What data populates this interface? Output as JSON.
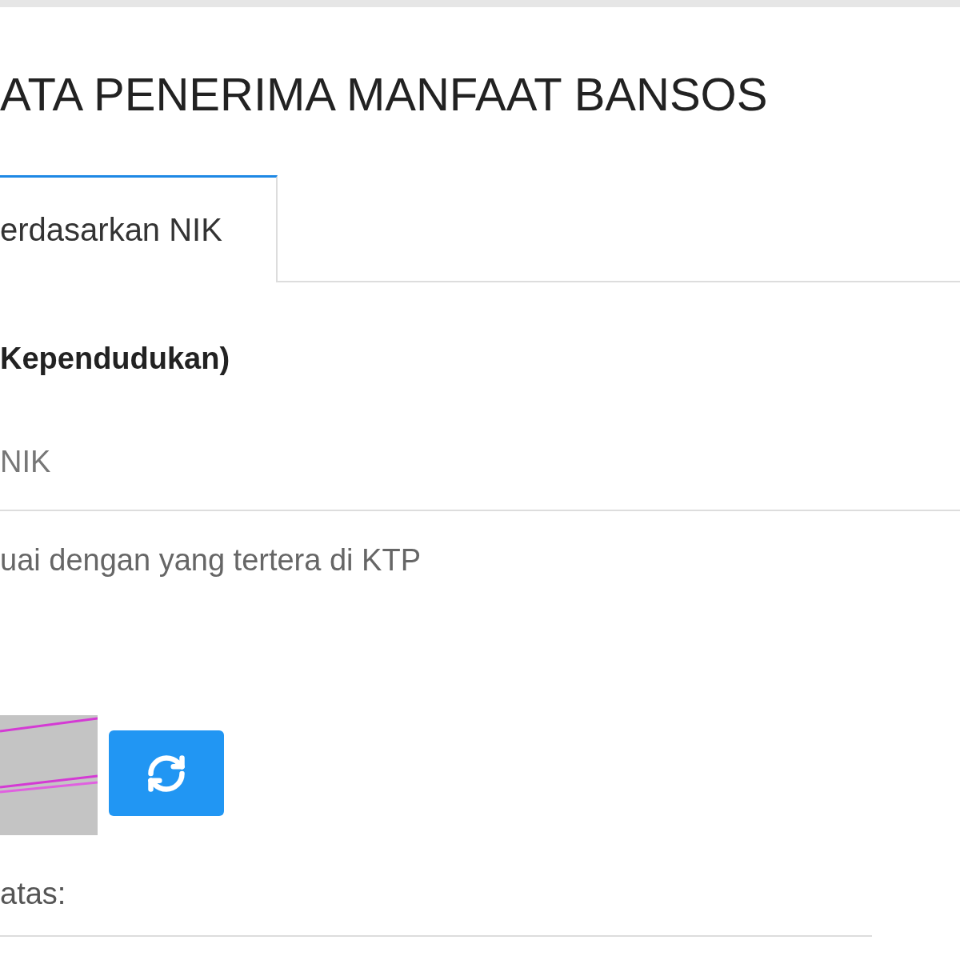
{
  "page_title": "ATA PENERIMA MANFAAT BANSOS",
  "tabs": [
    {
      "label": "erdasarkan NIK",
      "selected": true
    }
  ],
  "form": {
    "section_heading": "Kependudukan)",
    "nik_field": {
      "placeholder": "NIK"
    },
    "nik_help": "uai dengan yang tertera di KTP",
    "captcha_label": "atas:"
  }
}
